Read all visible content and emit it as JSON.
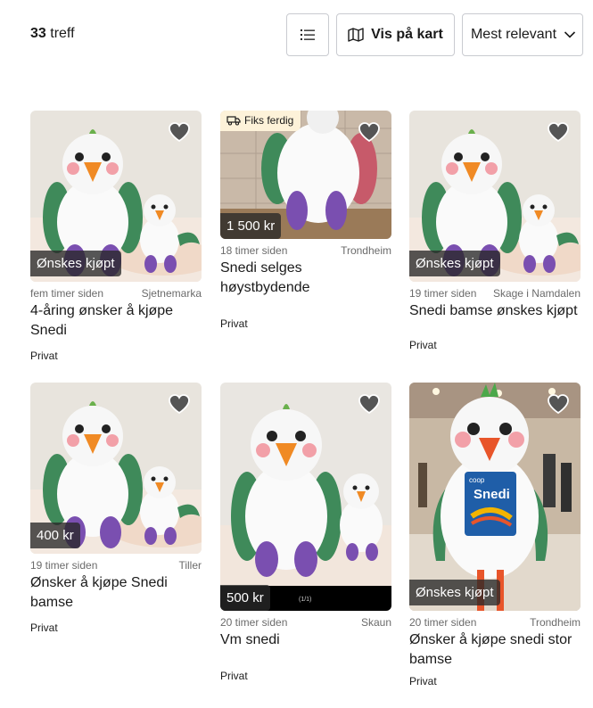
{
  "header": {
    "count_number": "33",
    "count_label": "treff",
    "map_button_label": "Vis på kart",
    "sort_label": "Mest relevant",
    "list_view_icon": "list-icon",
    "map_icon": "map-icon",
    "sort_icon": "chevron-down-icon"
  },
  "listings": [
    {
      "badge": "Ønskes kjøpt",
      "time": "fem timer siden",
      "location": "Sjetnemarka",
      "title": "4-åring ønsker å kjøpe Snedi",
      "seller": "Privat"
    },
    {
      "fiks": "Fiks ferdig",
      "badge": "1 500 kr",
      "time": "18 timer siden",
      "location": "Trondheim",
      "title": "Snedi selges høystbydende",
      "seller": "Privat"
    },
    {
      "badge": "Ønskes kjøpt",
      "time": "19 timer siden",
      "location": "Skage i Namdalen",
      "title": "Snedi bamse ønskes kjøpt",
      "seller": "Privat"
    },
    {
      "badge": "400 kr",
      "time": "19 timer siden",
      "location": "Tiller",
      "title": "Ønsker å kjøpe Snedi bamse",
      "seller": "Privat"
    },
    {
      "badge": "500 kr",
      "image_counter": "(1/1)",
      "time": "20 timer siden",
      "location": "Skaun",
      "title": "Vm snedi",
      "seller": "Privat"
    },
    {
      "badge": "Ønskes kjøpt",
      "time": "20 timer siden",
      "location": "Trondheim",
      "title": "Ønsker å kjøpe snedi stor bamse",
      "seller": "Privat",
      "mascot_shirt_top": "coop",
      "mascot_shirt_name": "Snedi"
    }
  ],
  "colors": {
    "border": "#c9cbd0",
    "badge_bg": "#282828",
    "fiks_bg": "#fdf2d9",
    "muted_text": "#6b6b6b"
  }
}
